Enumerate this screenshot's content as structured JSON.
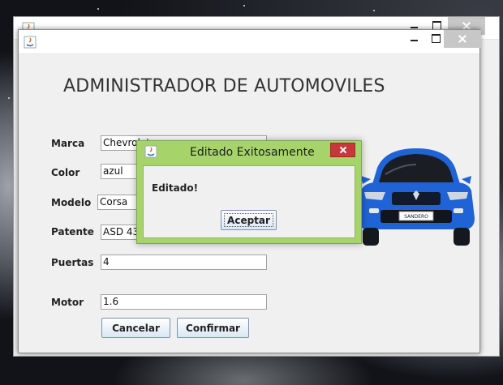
{
  "app": {
    "title": "ADMINISTRADOR DE AUTOMOVILES"
  },
  "form": {
    "fields": [
      {
        "label": "Marca",
        "value": "Chevrolet"
      },
      {
        "label": "Color",
        "value": "azul"
      },
      {
        "label": "Modelo",
        "value": "Corsa"
      },
      {
        "label": "Patente",
        "value": "ASD 432"
      },
      {
        "label": "Puertas",
        "value": "4"
      },
      {
        "label": "Motor",
        "value": "1.6"
      }
    ],
    "cancel_label": "Cancelar",
    "confirm_label": "Confirmar"
  },
  "dialog": {
    "title": "Editado Exitosamente",
    "message": "Editado!",
    "ok_label": "Aceptar"
  },
  "car": {
    "plate_text": "SANDERO",
    "body_color": "#1f63d6"
  },
  "colors": {
    "dialog_frame": "#a6d46a",
    "close_red": "#c8373a",
    "window_bg": "#f0f0f0"
  }
}
